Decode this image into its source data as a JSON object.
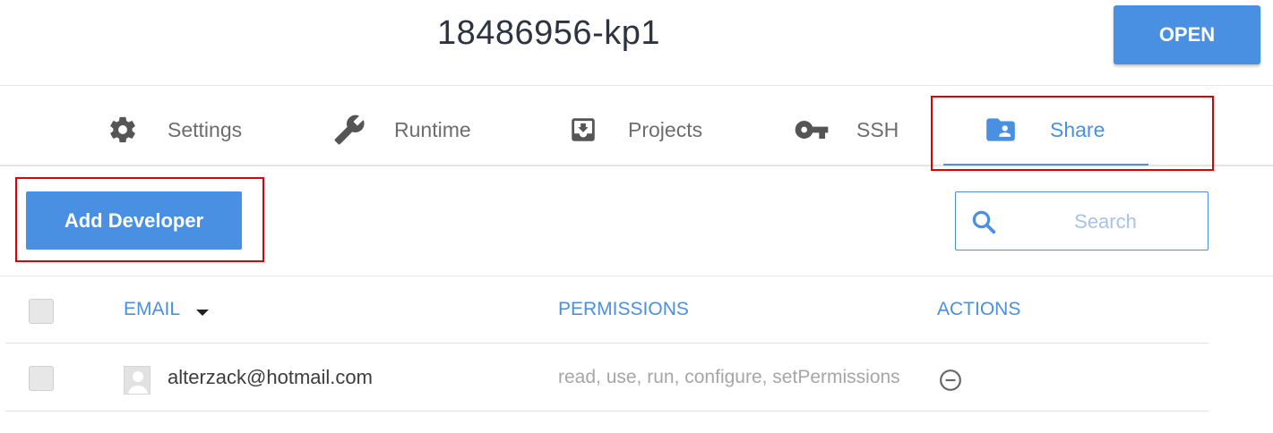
{
  "header": {
    "title": "18486956-kp1",
    "open_label": "OPEN"
  },
  "tabs": [
    {
      "label": "Settings",
      "icon": "gear-icon"
    },
    {
      "label": "Runtime",
      "icon": "wrench-icon"
    },
    {
      "label": "Projects",
      "icon": "download-box-icon"
    },
    {
      "label": "SSH",
      "icon": "key-icon"
    },
    {
      "label": "Share",
      "icon": "folder-user-icon",
      "active": true
    }
  ],
  "toolbar": {
    "add_developer_label": "Add Developer",
    "search_placeholder": "Search"
  },
  "table": {
    "columns": {
      "email": "EMAIL",
      "permissions": "PERMISSIONS",
      "actions": "ACTIONS"
    },
    "sort": {
      "column": "email",
      "direction": "descending"
    },
    "rows": [
      {
        "email": "alterzack@hotmail.com",
        "permissions": "read, use, run, configure, setPermissions",
        "action_icon": "remove-circle-icon"
      }
    ]
  },
  "colors": {
    "accent": "#4a90e2",
    "highlight": "#e00000",
    "text": "#2d3440",
    "muted_text": "#6d6d6d"
  }
}
